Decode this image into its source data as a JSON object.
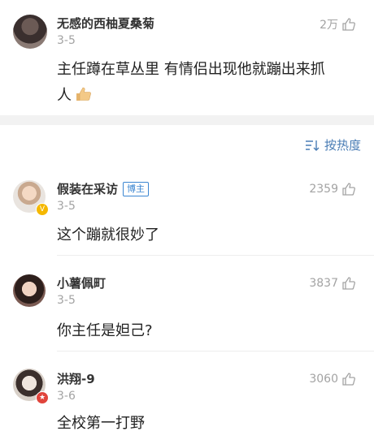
{
  "top_comment": {
    "name": "无感的西柚夏桑菊",
    "date": "3-5",
    "likes": "2万",
    "text_line1": "主任蹲在草丛里 有情侣出现他就蹦出来抓",
    "text_line2": "人"
  },
  "sort": {
    "label": "按热度"
  },
  "comments": [
    {
      "name": "假装在采访",
      "badge": "博主",
      "date": "3-5",
      "likes": "2359",
      "text": "这个蹦就很妙了"
    },
    {
      "name": "小薯佩町",
      "date": "3-5",
      "likes": "3837",
      "text": "你主任是妲己?"
    },
    {
      "name": "洪翔-9",
      "date": "3-6",
      "likes": "3060",
      "text": "全校第一打野"
    }
  ],
  "colors": {
    "accent": "#4a7db5",
    "muted": "#a3a3a3",
    "vip_badge": "#f5b800",
    "red_badge": "#e0443b"
  }
}
